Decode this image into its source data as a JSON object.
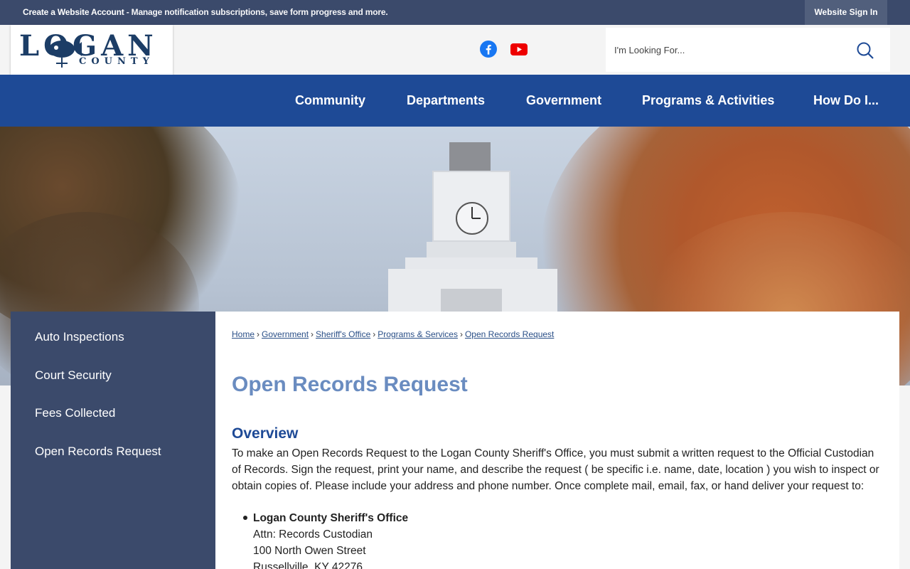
{
  "topbar": {
    "create_account": "Create a Website Account",
    "message": " - Manage notification subscriptions, save form progress and more.",
    "sign_in": "Website Sign In"
  },
  "logo": {
    "main": "LOGAN",
    "sub": "COUNTY"
  },
  "social": {
    "facebook": "facebook-icon",
    "youtube": "youtube-icon"
  },
  "search": {
    "placeholder": "I'm Looking For..."
  },
  "nav": {
    "items": [
      {
        "label": "Community"
      },
      {
        "label": "Departments"
      },
      {
        "label": "Government"
      },
      {
        "label": "Programs & Activities"
      },
      {
        "label": "How Do I..."
      }
    ]
  },
  "sidebar": {
    "items": [
      {
        "label": "Auto Inspections"
      },
      {
        "label": "Court Security"
      },
      {
        "label": "Fees Collected"
      },
      {
        "label": "Open Records Request"
      }
    ]
  },
  "breadcrumb": {
    "items": [
      "Home",
      "Government",
      "Sheriff's Office",
      "Programs & Services",
      "Open Records Request"
    ],
    "separator": "›"
  },
  "page": {
    "title": "Open Records Request",
    "overview_heading": "Overview",
    "overview_text": "To make an Open Records Request to the Logan County Sheriff's Office, you must submit a written request to the Official Custodian of Records. Sign the request, print your name, and describe the request ( be specific i.e. name, date, location ) you wish to inspect or obtain copies of. Please include your address and phone number. Once complete mail, email, fax, or hand deliver your request to:",
    "address": {
      "name": "Logan County Sheriff's Office",
      "attn": "Attn: Records Custodian",
      "street": "100 North Owen Street",
      "city": "Russellville, KY 42276"
    }
  },
  "colors": {
    "topbar": "#3b4a6b",
    "nav": "#1e4a96",
    "sidebar": "#3b4a6b",
    "title": "#6a8cc0",
    "heading": "#1e4a96"
  }
}
